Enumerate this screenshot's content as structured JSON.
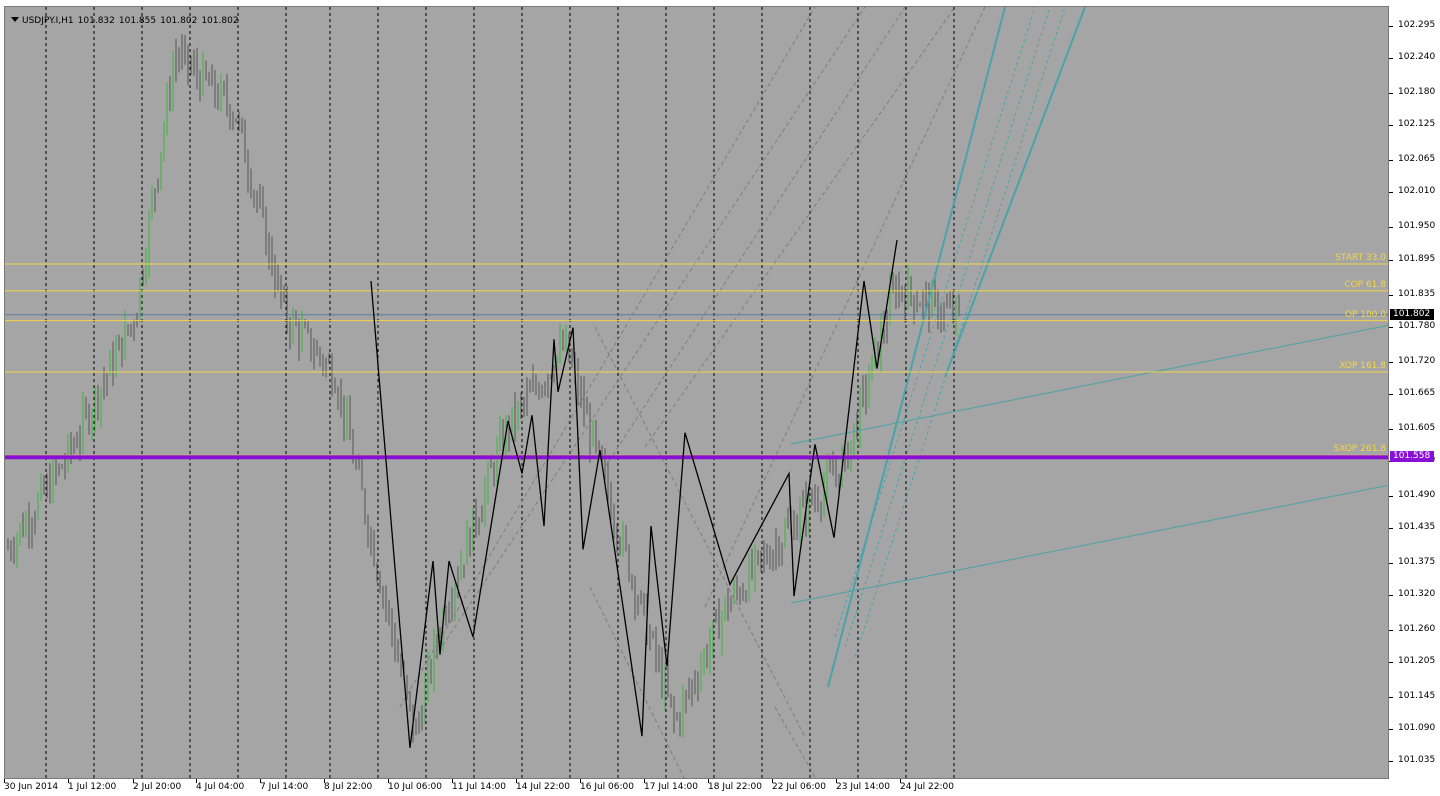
{
  "header": {
    "symbol": "USDJPY.I,H1",
    "open": "101.832",
    "high": "101.855",
    "low": "101.802",
    "close": "101.802"
  },
  "price_axis": {
    "labels": [
      "102.295",
      "102.240",
      "102.180",
      "102.125",
      "102.065",
      "102.010",
      "101.950",
      "101.895",
      "101.835",
      "101.780",
      "101.720",
      "101.665",
      "101.605",
      "101.550",
      "101.490",
      "101.435",
      "101.375",
      "101.320",
      "101.260",
      "101.205",
      "101.145",
      "101.090",
      "101.035"
    ],
    "current_price": "101.802",
    "level_price": "101.558"
  },
  "time_axis": {
    "labels": [
      "30 Jun 2014",
      "1 Jul 12:00",
      "2 Jul 20:00",
      "4 Jul 04:00",
      "7 Jul 14:00",
      "8 Jul 22:00",
      "10 Jul 06:00",
      "11 Jul 14:00",
      "14 Jul 22:00",
      "16 Jul 06:00",
      "17 Jul 14:00",
      "18 Jul 22:00",
      "22 Jul 06:00",
      "23 Jul 14:00",
      "24 Jul 22:00"
    ]
  },
  "fibo_levels": [
    {
      "label": "START 33.0",
      "price": 101.889
    },
    {
      "label": "COP 61.8",
      "price": 101.843
    },
    {
      "label": "OP 100.0",
      "price": 101.792
    },
    {
      "label": "XOP 161.8",
      "price": 101.704
    },
    {
      "label": "SXOP 261.8",
      "price": 101.561
    }
  ],
  "colors": {
    "background": "#a5a5a5",
    "candle": "#555555",
    "bull_candle": "#3cb53c",
    "zigzag": "#000000",
    "fibo": "#f2d64b",
    "level": "#8a0fd6",
    "channel": "#4aa3a8",
    "current_price_line": "#5a7fa0"
  },
  "chart_data": {
    "type": "line",
    "symbol": "USDJPY.I",
    "timeframe": "H1",
    "ylim": [
      101.03,
      102.32
    ],
    "grid": "vertical dashed day separators",
    "x": [
      "30 Jun 2014",
      "1 Jul 12:00",
      "2 Jul 20:00",
      "3 Jul",
      "4 Jul 04:00",
      "7 Jul 14:00",
      "8 Jul 22:00",
      "10 Jul 06:00",
      "10 Jul",
      "11 Jul 14:00",
      "14 Jul 22:00",
      "16 Jul 06:00",
      "17 Jul 14:00",
      "18 Jul 22:00",
      "22 Jul 06:00",
      "23 Jul 14:00",
      "24 Jul 22:00",
      "25 Jul"
    ],
    "close": [
      101.4,
      101.55,
      101.8,
      102.25,
      102.15,
      101.8,
      101.7,
      101.08,
      101.3,
      101.45,
      101.6,
      101.75,
      101.1,
      101.3,
      101.45,
      101.55,
      101.85,
      101.8
    ],
    "zigzag": [
      {
        "x": "8 Jul 22:00",
        "y": 101.86
      },
      {
        "x": "10 Jul 06:00",
        "y": 101.06
      },
      {
        "x": "10 Jul",
        "y": 101.38
      },
      {
        "x": "10 Jul",
        "y": 101.22
      },
      {
        "x": "11 Jul 14:00",
        "y": 101.38
      },
      {
        "x": "11 Jul 14:00",
        "y": 101.25
      },
      {
        "x": "14 Jul 22:00",
        "y": 101.62
      },
      {
        "x": "14 Jul 22:00",
        "y": 101.53
      },
      {
        "x": "14 Jul 22:00",
        "y": 101.63
      },
      {
        "x": "16 Jul 06:00",
        "y": 101.44
      },
      {
        "x": "16 Jul 06:00",
        "y": 101.76
      },
      {
        "x": "16 Jul 06:00",
        "y": 101.67
      },
      {
        "x": "16 Jul 06:00",
        "y": 101.78
      },
      {
        "x": "17 Jul 14:00",
        "y": 101.4
      },
      {
        "x": "17 Jul 14:00",
        "y": 101.57
      },
      {
        "x": "17 Jul 14:00",
        "y": 101.08
      },
      {
        "x": "18 Jul 22:00",
        "y": 101.44
      },
      {
        "x": "18 Jul 22:00",
        "y": 101.2
      },
      {
        "x": "22 Jul 06:00",
        "y": 101.6
      },
      {
        "x": "22 Jul 06:00",
        "y": 101.34
      },
      {
        "x": "22 Jul 06:00",
        "y": 101.53
      },
      {
        "x": "23 Jul 14:00",
        "y": 101.32
      },
      {
        "x": "23 Jul 14:00",
        "y": 101.58
      },
      {
        "x": "23 Jul 14:00",
        "y": 101.42
      },
      {
        "x": "24 Jul 22:00",
        "y": 101.86
      },
      {
        "x": "24 Jul 22:00",
        "y": 101.71
      },
      {
        "x": "24 Jul 22:00",
        "y": 101.93
      }
    ],
    "horizontal_levels": [
      {
        "label": "START 33.0",
        "y": 101.889
      },
      {
        "label": "COP 61.8",
        "y": 101.843
      },
      {
        "label": "OP 100.0",
        "y": 101.792
      },
      {
        "label": "XOP 161.8",
        "y": 101.704
      },
      {
        "label": "SXOP 261.8",
        "y": 101.561
      },
      {
        "label": "101.558",
        "y": 101.558
      }
    ]
  }
}
